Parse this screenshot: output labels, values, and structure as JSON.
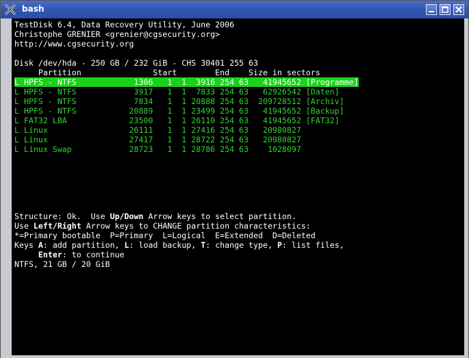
{
  "window": {
    "title": "bash",
    "icons": {
      "app": "x-icon",
      "minimize": "minimize-icon",
      "maximize": "maximize-icon",
      "close": "close-icon"
    }
  },
  "colors": {
    "terminal_bg": "#000000",
    "text": "#ffffff",
    "partition_text": "#35d235",
    "selected_bg": "#19d219",
    "titlebar": "#3358b4"
  },
  "header": [
    "TestDisk 6.4, Data Recovery Utility, June 2006",
    "Christophe GRENIER <grenier@cgsecurity.org>",
    "http://www.cgsecurity.org"
  ],
  "disk_info": "Disk /dev/hda - 250 GB / 232 GiB - CHS 30401 255 63",
  "column_header": "     Partition               Start        End    Size in sectors",
  "partitions": [
    "L HPFS - NTFS            1306   1  1  3916 254 63   41945652 [Programme]",
    "L HPFS - NTFS            3917   1  1  7833 254 63   62926542 [Daten]",
    "L HPFS - NTFS            7834   1  1 20888 254 63  209728512 [Archiv]",
    "L HPFS - NTFS           20889   1  1 23499 254 63   41945652 [Backup]",
    "L FAT32 LBA             23500   1  1 26110 254 63   41945652 [FAT32]",
    "L Linux                 26111   1  1 27416 254 63   20980827",
    "L Linux                 27417   1  1 28722 254 63   20980827",
    "L Linux Swap            28723   1  1 28786 254 63    1028097"
  ],
  "help": {
    "line1_a": "Structure: Ok.  Use ",
    "line1_key": "Up/Down",
    "line1_b": " Arrow keys to select partition.",
    "line2_a": "Use ",
    "line2_key": "Left/Right",
    "line2_b": " Arrow keys to CHANGE partition characteristics:",
    "line3": "*=Primary bootable  P=Primary  L=Logical  E=Extended  D=Deleted",
    "line4_a": "Keys ",
    "line4_k1": "A",
    "line4_b": ": add partition, ",
    "line4_k2": "L",
    "line4_c": ": load backup, ",
    "line4_k3": "T",
    "line4_d": ": change type, ",
    "line4_k4": "P",
    "line4_e": ": list files,",
    "line5_a": "     ",
    "line5_key": "Enter",
    "line5_b": ": to continue",
    "status": "NTFS, 21 GB / 20 GiB"
  }
}
